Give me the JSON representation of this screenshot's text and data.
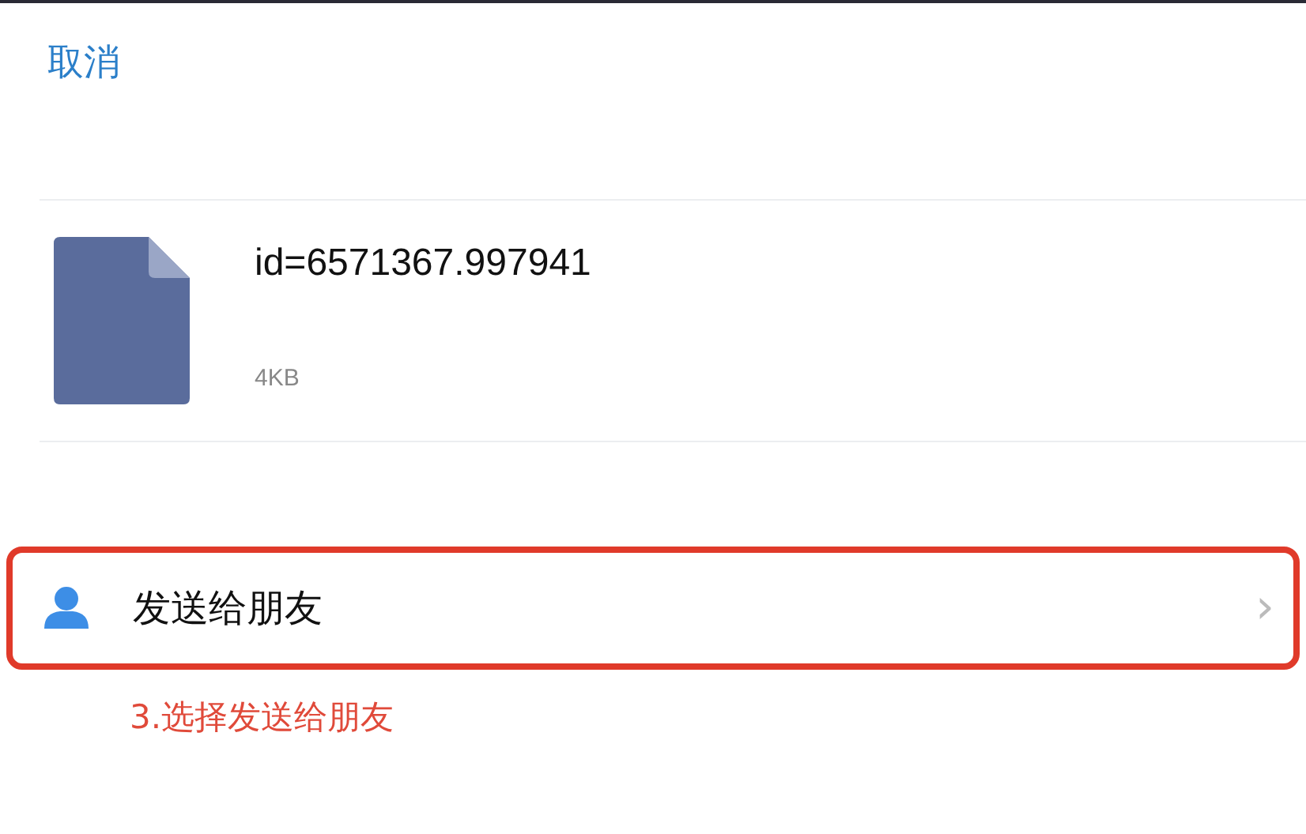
{
  "cancel_button": "取消",
  "file": {
    "name": "id=6571367.997941",
    "size": "4KB"
  },
  "actions": [
    {
      "label": "发送给朋友",
      "chevron": "›",
      "highlighted": true
    }
  ],
  "annotation": "3.选择发送给朋友"
}
